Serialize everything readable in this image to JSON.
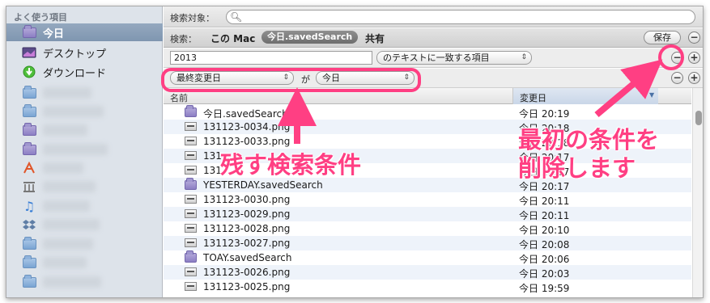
{
  "sidebar": {
    "header": "よく使う項目",
    "items": [
      {
        "label": "今日",
        "icon": "smart-folder-icon"
      },
      {
        "label": "デスクトップ",
        "icon": "desktop-icon"
      },
      {
        "label": "ダウンロード",
        "icon": "download-icon"
      }
    ]
  },
  "search": {
    "label": "検索対象：",
    "placeholder": ""
  },
  "scope": {
    "label": "検索：",
    "this_mac": "この Mac",
    "selected": "今日.savedSearch",
    "shared": "共有",
    "save_label": "保存"
  },
  "criteria": [
    {
      "value": "2013",
      "operator": "のテキストに一致する項目"
    },
    {
      "attribute": "最終変更日",
      "connector": "が",
      "value": "今日"
    }
  ],
  "columns": {
    "name": "名前",
    "date": "変更日"
  },
  "files": [
    {
      "name": "今日.savedSearch",
      "date": "今日 20:19",
      "type": "smart"
    },
    {
      "name": "131123-0034.png",
      "date": "今日 20:18",
      "type": "png"
    },
    {
      "name": "131123-0033.png",
      "date": "今日 20:18",
      "type": "png"
    },
    {
      "name": "131",
      "date": "今日 20:17",
      "type": "png"
    },
    {
      "name": "131",
      "date": "今日 20:17",
      "type": "png"
    },
    {
      "name": "YESTERDAY.savedSearch",
      "date": "今日 20:17",
      "type": "smart"
    },
    {
      "name": "131123-0030.png",
      "date": "今日 20:11",
      "type": "png"
    },
    {
      "name": "131123-0029.png",
      "date": "今日 20:11",
      "type": "png"
    },
    {
      "name": "131123-0028.png",
      "date": "今日 20:10",
      "type": "png"
    },
    {
      "name": "131123-0027.png",
      "date": "今日 20:08",
      "type": "png"
    },
    {
      "name": "TOAY.savedSearch",
      "date": "今日 20:06",
      "type": "smart"
    },
    {
      "name": "131123-0026.png",
      "date": "今日 20:03",
      "type": "png"
    },
    {
      "name": "131123-0025.png",
      "date": "今日 19:59",
      "type": "png"
    }
  ],
  "annotations": {
    "keep": "残す検索条件",
    "remove_line1": "最初の条件を",
    "remove_line2": "削除します",
    "color": "#ff3f83"
  }
}
